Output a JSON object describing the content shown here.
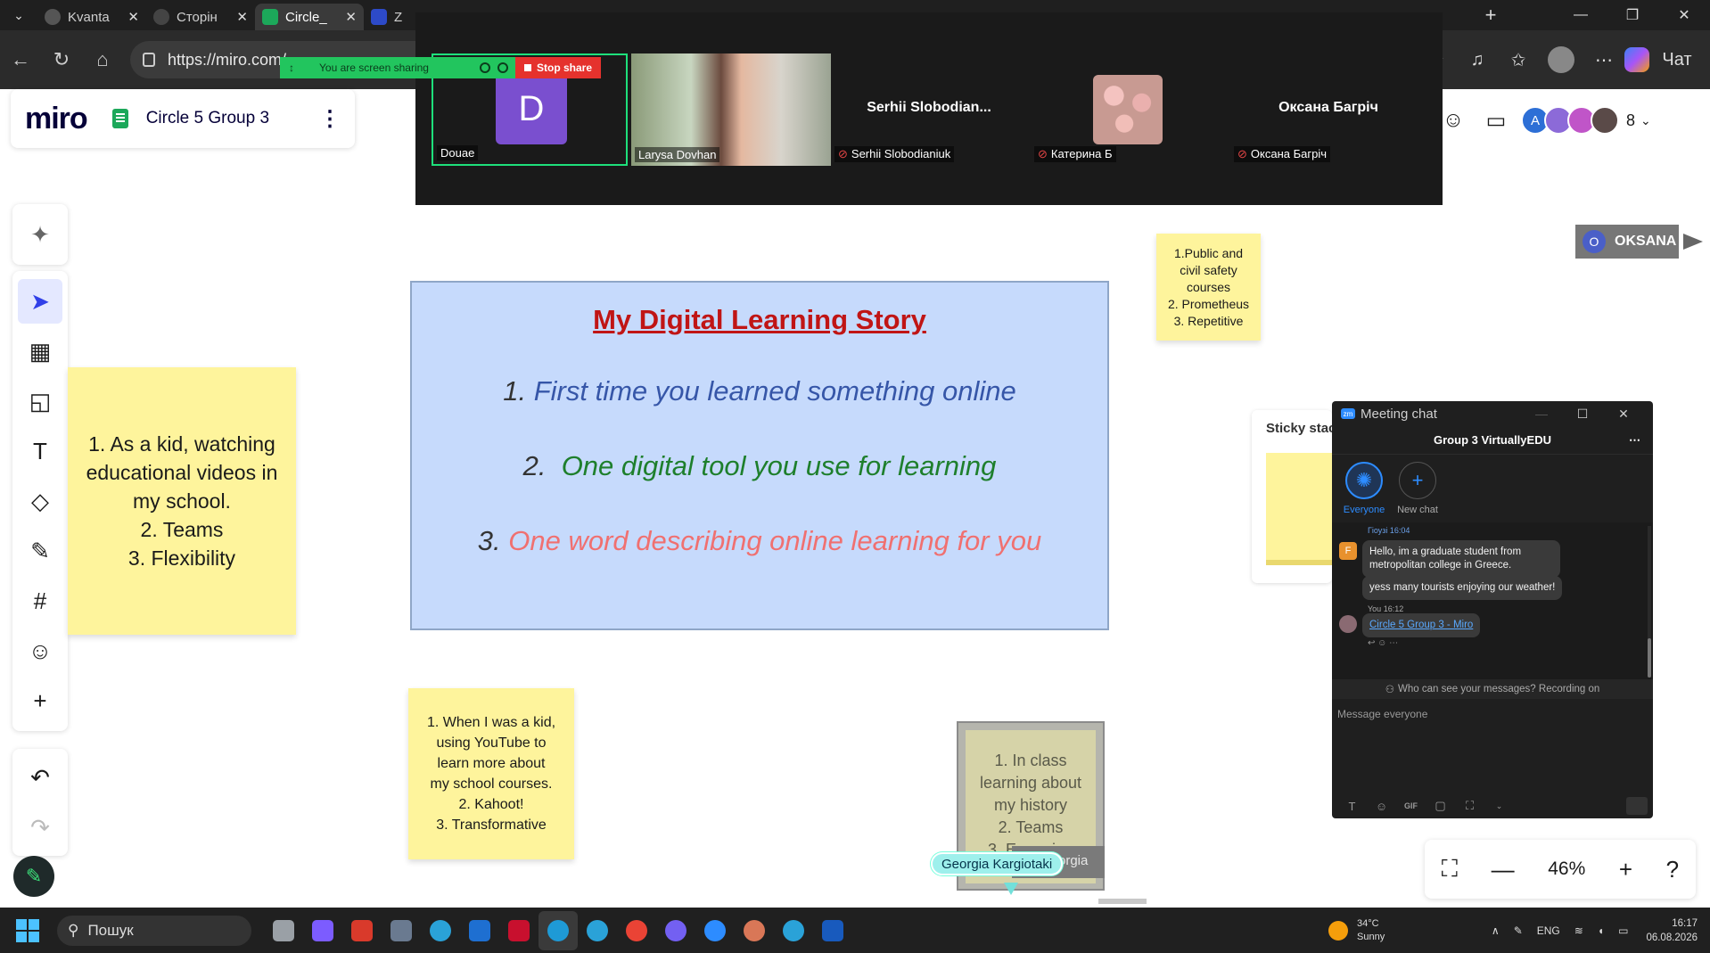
{
  "browser": {
    "tabs": [
      {
        "label": "Kvanta",
        "color": "#555555"
      },
      {
        "label": "Сторін",
        "color": "#444444"
      },
      {
        "label": "Circle_",
        "color": "#1ca85a"
      },
      {
        "label": "Z",
        "color": "#2d4ac8"
      }
    ],
    "url": "https://miro.com/",
    "copilot_label": "Чат"
  },
  "miro": {
    "logo": "miro",
    "board_name": "Circle 5 Group 3",
    "user_count": "8",
    "zoom_level": "46%",
    "avatars": [
      {
        "letter": "A",
        "color": "#2d6fd6"
      },
      {
        "letter": "",
        "color": "#8c6ad8"
      },
      {
        "letter": "",
        "color": "#c055c8"
      },
      {
        "letter": "",
        "color": "#5a4a48"
      }
    ]
  },
  "frame": {
    "title": "My Digital Learning Story",
    "questions": [
      {
        "num": "1.",
        "text": "First time you learned something online"
      },
      {
        "num": "2.",
        "text": "One digital tool you use for learning"
      },
      {
        "num": "3.",
        "text": "One word describing online learning for you"
      }
    ]
  },
  "stickies": {
    "left": "1. As a kid, watching\neducational videos in\nmy school.\n2. Teams\n3. Flexibility",
    "bottom": "1. When I was a kid,\nusing YouTube to\nlearn more about\nmy school courses.\n2. Kahoot!\n3. Transformative",
    "top": "1.Public and\ncivil safety\ncourses\n2. Prometheus\n3. Repetitive",
    "grey": "1. In class\nlearning about\nmy history\n2.  Teams\n3. Engaging",
    "grey_overlay": "orgia",
    "stack_label": "Sticky stac"
  },
  "cursors": {
    "georgia": "Georgia Kargiotaki",
    "oksana_initial": "O",
    "oksana": "OKSANA"
  },
  "zoom_meeting": {
    "share_label": "You are screen sharing",
    "stop_share": "Stop share",
    "tiles": [
      {
        "initial": "D",
        "name": "Douae",
        "muted": false
      },
      {
        "title": "",
        "name": "Larysa Dovhan",
        "muted": false
      },
      {
        "title": "Serhii  Slobodian...",
        "name": "Serhii Slobodianiuk",
        "muted": true
      },
      {
        "title": "",
        "name": "Катерина Б",
        "muted": true
      },
      {
        "title": "Оксана Багріч",
        "name": "Оксана Багріч",
        "muted": true
      }
    ]
  },
  "chat": {
    "window_title": "Meeting chat",
    "group_name": "Group 3 VirtuallyEDU",
    "tab_everyone": "Everyone",
    "tab_new_chat": "New chat",
    "messages": [
      {
        "meta": "Гіоузі 16:04",
        "text": "Hello, im a graduate student from metropolitan college in Greece.",
        "initial": "F"
      },
      {
        "text": "yess many tourists enjoying our weather!"
      },
      {
        "meta": "You 16:12",
        "text": "Circle 5 Group 3 - Miro"
      }
    ],
    "notice": "Who can see your messages? Recording on",
    "input_placeholder": "Message everyone",
    "gif_label": "GIF"
  },
  "taskbar": {
    "search": "Пошук",
    "weather_temp": "34°C",
    "weather_desc": "Sunny",
    "language": "ENG",
    "time": "16:17",
    "date": "06.08.2026",
    "apps": [
      "#9aa0a6",
      "#7c5cff",
      "#d93a2b",
      "#6a7a90",
      "#2aa2d8",
      "#1e6fd1",
      "#c8102e",
      "#1e9ad6",
      "#2aa2d8",
      "#ea4335",
      "#7360f2",
      "#2d8cff",
      "#d97757",
      "#2aa2d8",
      "#185abd"
    ]
  }
}
